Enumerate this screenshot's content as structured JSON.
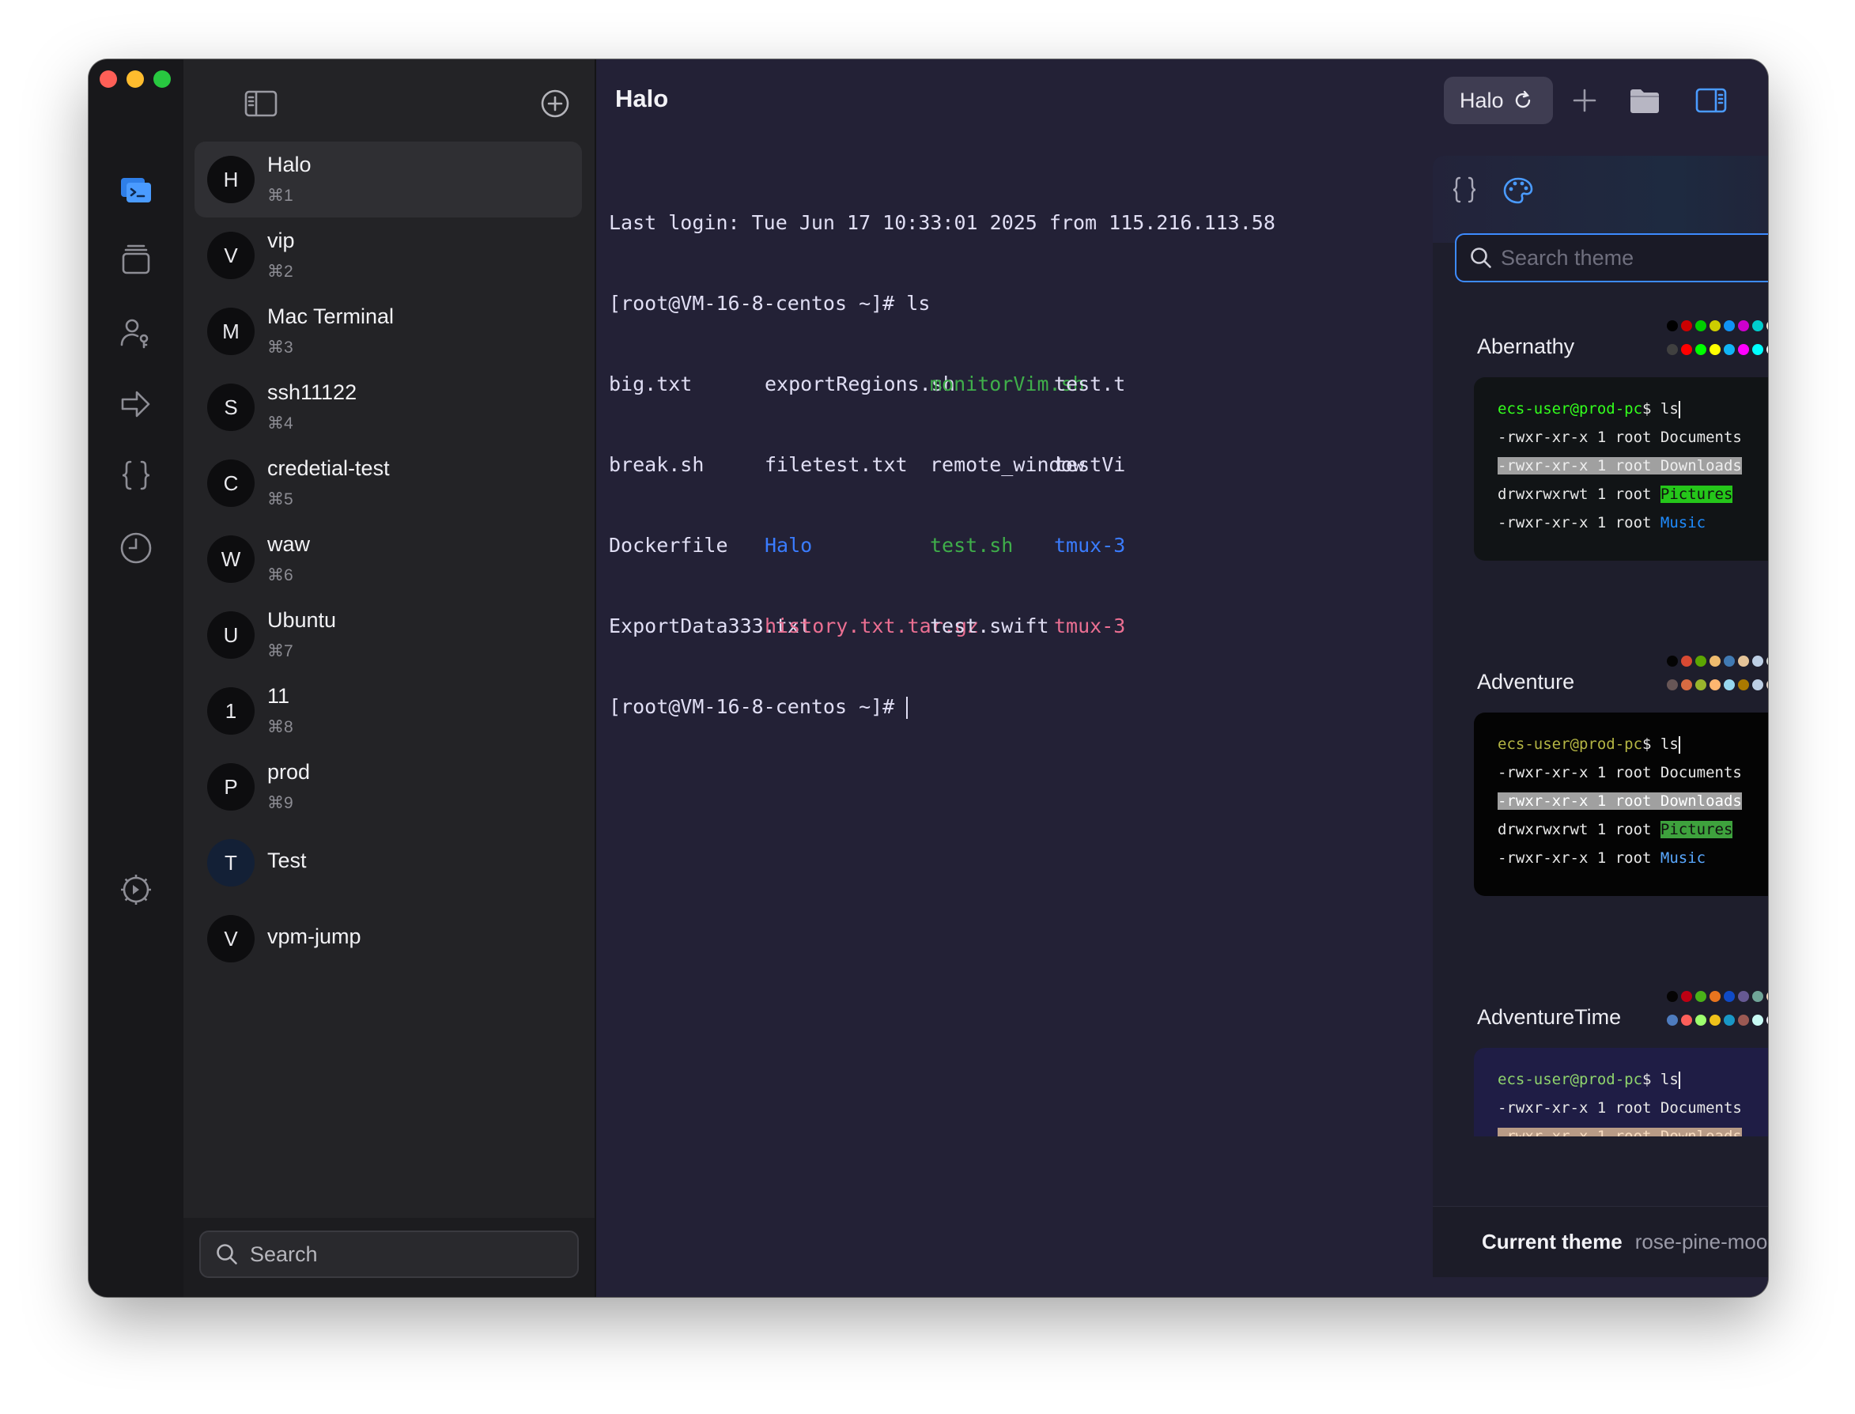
{
  "sidebar": {
    "sessions": [
      {
        "initial": "H",
        "name": "Halo",
        "shortcut": "⌘1"
      },
      {
        "initial": "V",
        "name": "vip",
        "shortcut": "⌘2"
      },
      {
        "initial": "M",
        "name": "Mac Terminal",
        "shortcut": "⌘3"
      },
      {
        "initial": "S",
        "name": "ssh11122",
        "shortcut": "⌘4"
      },
      {
        "initial": "C",
        "name": "credetial-test",
        "shortcut": "⌘5"
      },
      {
        "initial": "W",
        "name": "waw",
        "shortcut": "⌘6"
      },
      {
        "initial": "U",
        "name": "Ubuntu",
        "shortcut": "⌘7"
      },
      {
        "initial": "1",
        "name": "11",
        "shortcut": "⌘8"
      },
      {
        "initial": "P",
        "name": "prod",
        "shortcut": "⌘9"
      },
      {
        "initial": "T",
        "name": "Test"
      },
      {
        "initial": "V",
        "name": "vpm-jump"
      }
    ],
    "search_label": "Search"
  },
  "main": {
    "title": "Halo",
    "theme_chip": "Halo"
  },
  "terminal": {
    "login_line": "Last login: Tue Jun 17 10:33:01 2025 from 115.216.113.58",
    "prompt1": "[root@VM-16-8-centos ~]# ls",
    "files": [
      [
        "big.txt",
        "exportRegions.sh",
        "monitorVim.sh",
        "test.t"
      ],
      [
        "break.sh",
        "filetest.txt",
        "remote_window",
        "testVi"
      ],
      [
        "Dockerfile",
        "Halo",
        "test.sh",
        "tmux-3"
      ],
      [
        "ExportData333.txt",
        "history.txt.tar.gz",
        "test.swift",
        "tmux-3"
      ]
    ],
    "prompt2": "[root@VM-16-8-centos ~]# "
  },
  "theme_panel": {
    "search_placeholder": "Search theme",
    "preview": {
      "prompt": "ecs-user@prod-pc",
      "command": "$ ls",
      "line1": "-rwxr-xr-x 1 root Documents",
      "line2": "-rwxr-xr-x 1 root Downloads",
      "line3_prefix": "drwxrwxrwt 1 root ",
      "line3_dir": "Pictures",
      "line4_prefix": "-rwxr-xr-x 1 root ",
      "line4_dir": "Music"
    },
    "themes": [
      {
        "name": "Abernathy",
        "bg": "#111416",
        "prompt_color": "#33ff1d",
        "sel_bg": "#a0a0a0",
        "sel_fg": "#eeeeee",
        "dir_bg": "#25c61a",
        "dir_fg": "#111111",
        "music_color": "#1f8cff",
        "row1": [
          "#000000",
          "#cd0000",
          "#00cd00",
          "#cdcd00",
          "#1093f5",
          "#cd00cd",
          "#00cdcd",
          "#faebd7"
        ],
        "row2": [
          "#404040",
          "#ff0000",
          "#00ff00",
          "#ffff00",
          "#11b5f6",
          "#ff00ff",
          "#00ffff",
          "#ffffff"
        ]
      },
      {
        "name": "Adventure",
        "bg": "#040404",
        "prompt_color": "#b4b544",
        "sel_bg": "#a0a0a0",
        "sel_fg": "#feffff",
        "dir_bg": "#3ea23d",
        "dir_fg": "#111111",
        "music_color": "#59a8ff",
        "row1": [
          "#040404",
          "#d84a33",
          "#5da602",
          "#eebb6e",
          "#417ab3",
          "#e5c499",
          "#bdcfe5",
          "#dbded8"
        ],
        "row2": [
          "#685656",
          "#d76b42",
          "#99b52c",
          "#ffb670",
          "#97d7ef",
          "#aa7900",
          "#bdcfe5",
          "#e4d5c7"
        ]
      },
      {
        "name": "AdventureTime",
        "bg": "#1f1d45",
        "prompt_color": "#8fd46d",
        "sel_bg": "#b89b86",
        "sel_fg": "#f8dcc0",
        "dir_bg": "#3ea23d",
        "dir_fg": "#111111",
        "music_color": "#59a8ff",
        "row1": [
          "#050404",
          "#bd0013",
          "#4ab118",
          "#e7741e",
          "#0f4ac6",
          "#665993",
          "#70a598",
          "#f8dcc0"
        ],
        "row2": [
          "#4e7cbf",
          "#fc5f5a",
          "#9eff6e",
          "#efc11a",
          "#1997c6",
          "#9b5953",
          "#c8faf4",
          "#f6f5fb"
        ]
      }
    ],
    "current_theme_label": "Current theme",
    "current_theme_value": "rose-pine-moon"
  }
}
